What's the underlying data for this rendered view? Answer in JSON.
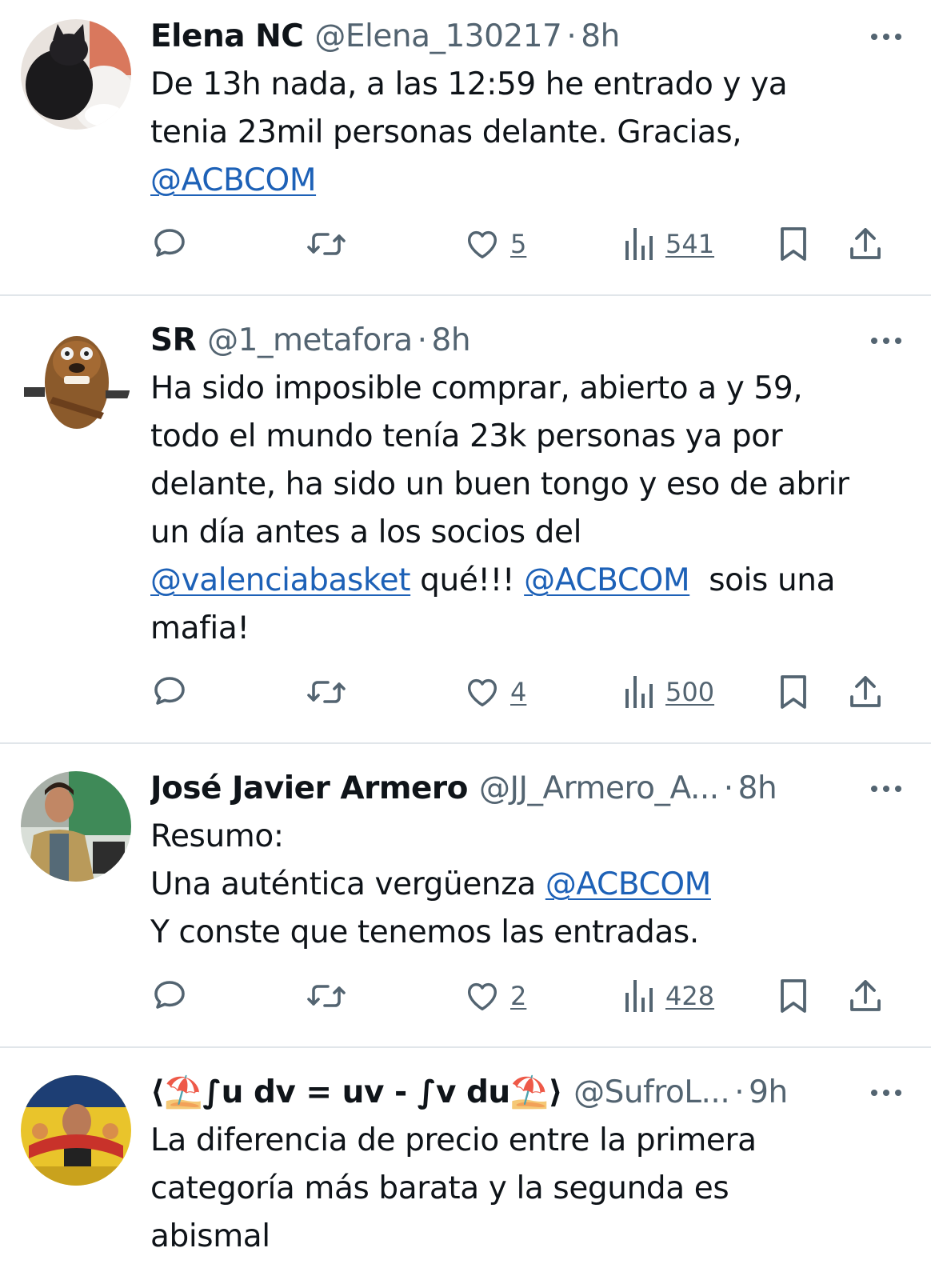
{
  "colors": {
    "text": "#0f1419",
    "secondary": "#536471",
    "mention": "#1d61b7",
    "divider": "#e1e6ea"
  },
  "icons": {
    "reply": "speech-bubble-icon",
    "retweet": "retweet-arrows-icon",
    "like": "heart-icon",
    "views": "bar-chart-icon",
    "bookmark": "bookmark-icon",
    "share": "share-upload-icon",
    "more": "more-horizontal-dots-icon"
  },
  "tweets": [
    {
      "name": "Elena NC",
      "handle": "@Elena_130217",
      "dot": "·",
      "time": "8h",
      "text_parts": [
        {
          "t": "De 13h nada, a las 12:59 he entrado y ya\ntenia 23mil personas delante. Gracias,\n"
        },
        {
          "t": "@ACBCOM",
          "mention": true
        }
      ],
      "likes": "5",
      "views": "541"
    },
    {
      "name": "SR",
      "handle": "@1_metafora",
      "dot": "·",
      "time": "8h",
      "text_parts": [
        {
          "t": "Ha sido imposible comprar, abierto a y 59,\ntodo el mundo tenía 23k personas ya por\ndelante, ha sido un buen tongo y eso de abrir\nun día antes a los socios del\n"
        },
        {
          "t": "@valenciabasket",
          "mention": true
        },
        {
          "t": " qué!!! "
        },
        {
          "t": "@ACBCOM",
          "mention": true
        },
        {
          "t": "  sois una\nmafia!"
        }
      ],
      "likes": "4",
      "views": "500"
    },
    {
      "name": "José Javier Armero",
      "handle": "@JJ_Armero_A...",
      "dot": "·",
      "time": "8h",
      "text_parts": [
        {
          "t": "Resumo:\nUna auténtica vergüenza "
        },
        {
          "t": "@ACBCOM",
          "mention": true
        },
        {
          "t": "\nY conste que tenemos las entradas."
        }
      ],
      "likes": "2",
      "views": "428"
    },
    {
      "name": "⟨⛱️∫u dv = uv - ∫v du⛱️⟩",
      "handle": "@SufroL...",
      "dot": "·",
      "time": "9h",
      "text_parts": [
        {
          "t": "La diferencia de precio entre la primera\ncategoría más barata y la segunda es\nabismal"
        }
      ],
      "likes": "",
      "views": ""
    }
  ]
}
